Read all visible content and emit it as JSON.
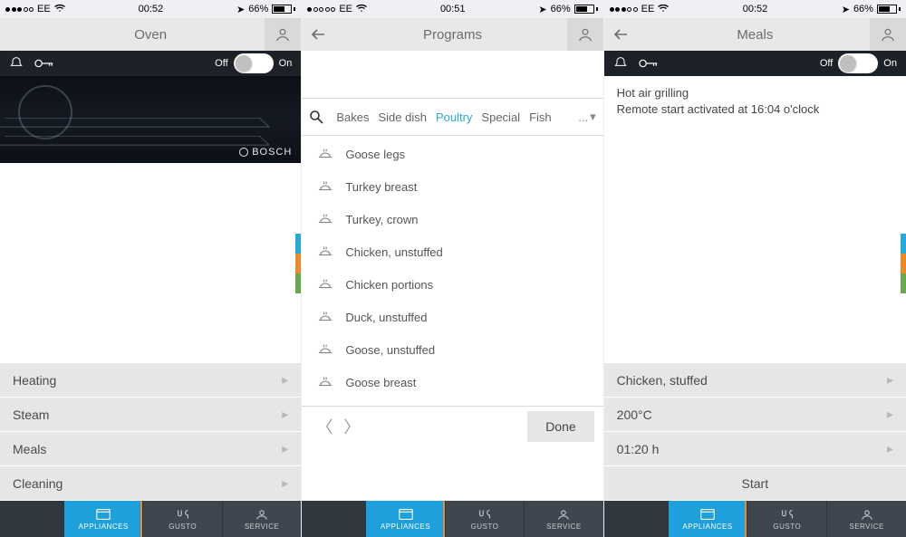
{
  "statusbar": {
    "carrier": "EE",
    "time1": "00:52",
    "time2": "00:51",
    "time3": "00:52",
    "battery": "66%",
    "signal_filled_1": 3,
    "signal_filled_2": 1,
    "signal_filled_3": 3
  },
  "screen1": {
    "title": "Oven",
    "toggle_off": "Off",
    "toggle_on": "On",
    "brand": "BOSCH",
    "rows": [
      "Heating",
      "Steam",
      "Meals",
      "Cleaning"
    ]
  },
  "screen2": {
    "title": "Programs",
    "categories": [
      "Bakes",
      "Side dish",
      "Poultry",
      "Special",
      "Fish"
    ],
    "active_category_index": 2,
    "more": "...",
    "programs": [
      "Goose legs",
      "Turkey breast",
      "Turkey, crown",
      "Chicken, unstuffed",
      "Chicken portions",
      "Duck, unstuffed",
      "Goose, unstuffed",
      "Goose breast"
    ],
    "done": "Done"
  },
  "screen3": {
    "title": "Meals",
    "toggle_off": "Off",
    "toggle_on": "On",
    "info_line1": "Hot air grilling",
    "info_line2": "Remote start activated at 16:04 o'clock",
    "rows": [
      "Chicken, stuffed",
      "200°C",
      "01:20 h"
    ],
    "start": "Start"
  },
  "tabs": {
    "appliances": "APPLIANCES",
    "gusto": "GUSTO",
    "service": "SERVICE"
  },
  "accent_colors": [
    "#2aa8d8",
    "#e98a2e",
    "#6aa84f"
  ]
}
